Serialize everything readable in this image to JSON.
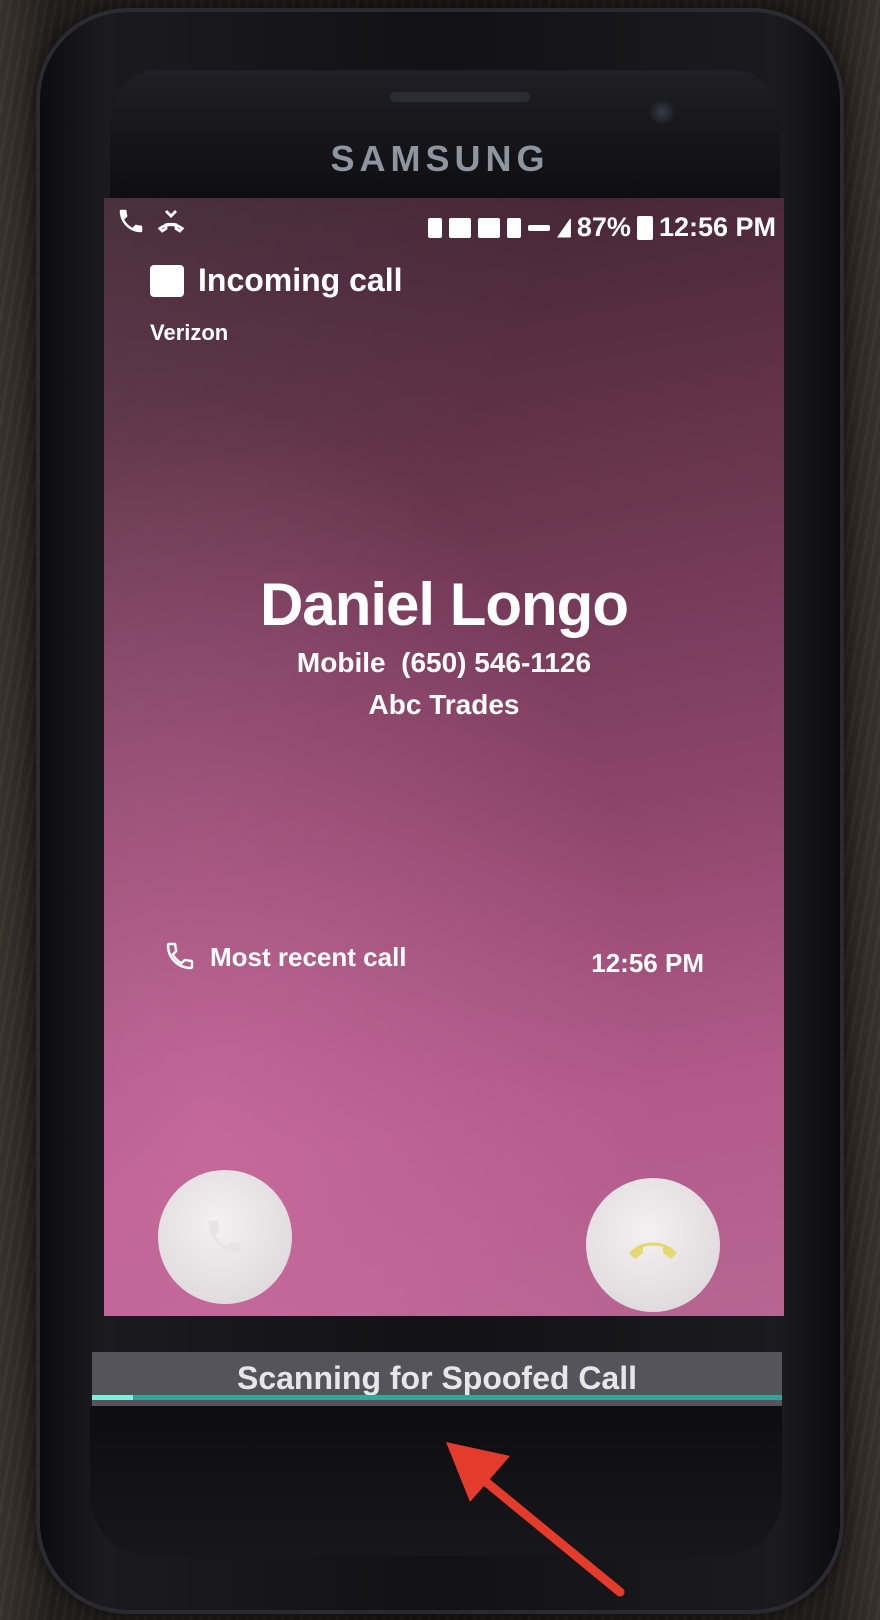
{
  "device": {
    "brand": "SAMSUNG"
  },
  "status_bar": {
    "battery": "87%",
    "time": "12:56 PM"
  },
  "notification": {
    "title": "Incoming call",
    "carrier": "Verizon"
  },
  "caller": {
    "name": "Daniel Longo",
    "number_type": "Mobile",
    "number": "(650) 546-1126",
    "organization": "Abc Trades"
  },
  "recent_call": {
    "label": "Most recent call",
    "time": "12:56 PM"
  },
  "actions": {
    "accept_icon": "phone-icon",
    "decline_icon": "phone-hangup-icon"
  },
  "scan": {
    "label": "Scanning for Spoofed Call",
    "progress": 0.06,
    "track_color": "#2fa89b",
    "fill_color": "#7bf0df"
  },
  "annotation": {
    "arrow_color": "#e53b2c"
  }
}
